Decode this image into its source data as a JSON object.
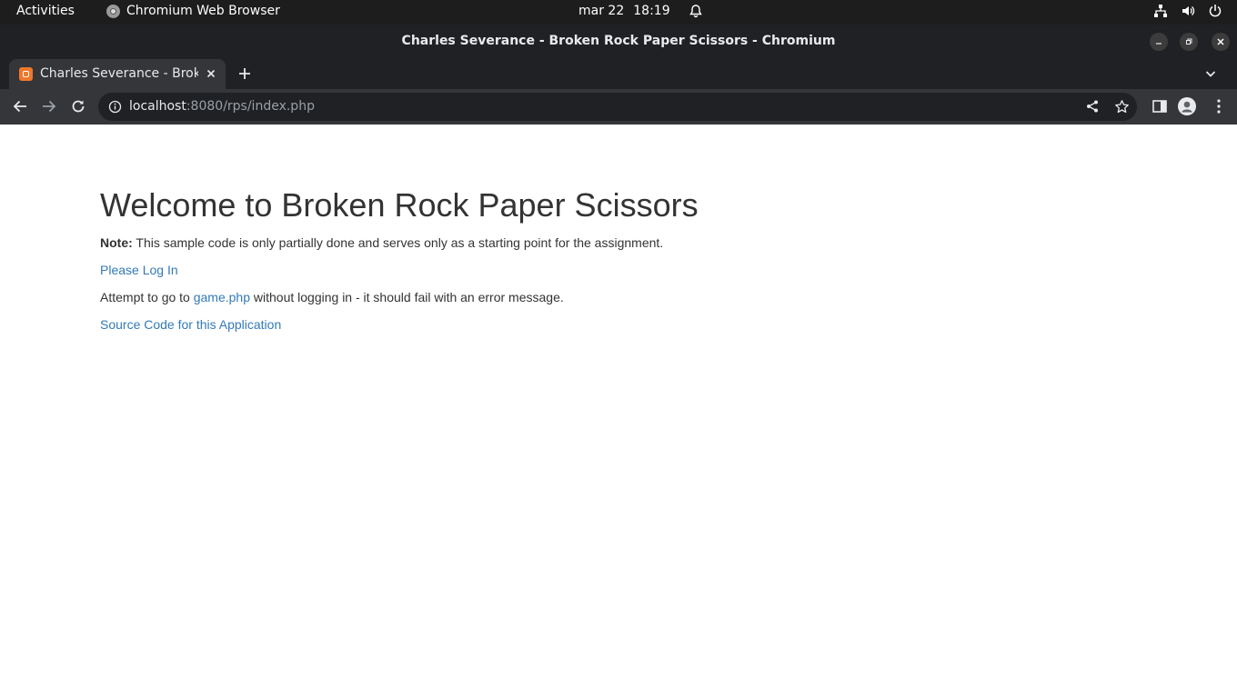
{
  "system_bar": {
    "activities": "Activities",
    "app_name": "Chromium Web Browser",
    "date": "mar 22",
    "time": "18:19"
  },
  "window": {
    "title": "Charles Severance - Broken Rock Paper Scissors - Chromium"
  },
  "tabs": [
    {
      "title": "Charles Severance - Broken Rock Paper Scissors",
      "active": true
    }
  ],
  "address_bar": {
    "host": "localhost",
    "rest": ":8080/rps/index.php"
  },
  "page": {
    "heading": "Welcome to Broken Rock Paper Scissors",
    "note_label": "Note:",
    "note_text": " This sample code is only partially done and serves only as a starting point for the assignment.",
    "login_link": "Please Log In",
    "attempt_prefix": "Attempt to go to ",
    "attempt_link": "game.php",
    "attempt_suffix": " without logging in - it should fail with an error message.",
    "source_link": "Source Code for this Application"
  },
  "colors": {
    "link": "#337ab7",
    "text": "#333333",
    "chrome_dark": "#202124",
    "chrome_toolbar": "#35363a"
  },
  "icons": [
    "chromium-icon",
    "bell-icon",
    "network-icon",
    "volume-icon",
    "power-icon",
    "minimize-icon",
    "maximize-icon",
    "close-icon",
    "xampp-favicon",
    "tab-close-icon",
    "new-tab-icon",
    "tab-search-icon",
    "back-icon",
    "forward-icon",
    "reload-icon",
    "info-icon",
    "share-icon",
    "bookmark-star-icon",
    "side-panel-icon",
    "profile-icon",
    "menu-icon"
  ]
}
